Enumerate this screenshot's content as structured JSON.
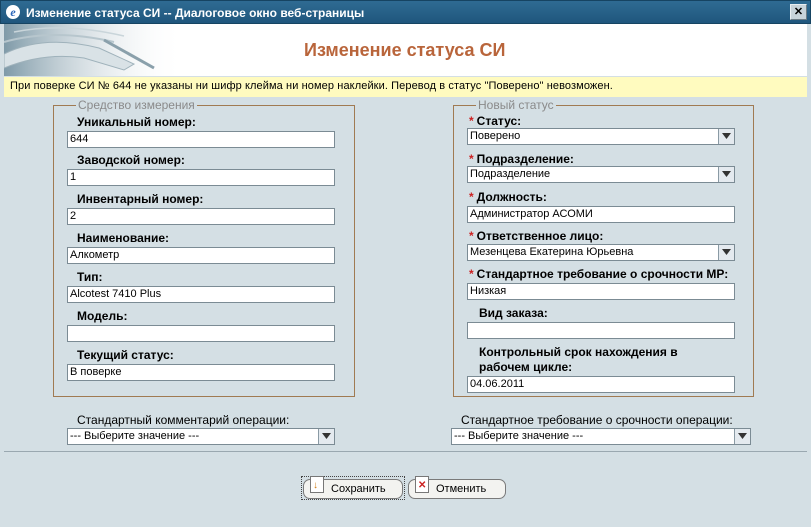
{
  "window": {
    "title": "Изменение статуса СИ -- Диалоговое окно веб-страницы",
    "close_symbol": "✕"
  },
  "header": {
    "heading": "Изменение статуса СИ"
  },
  "warning": "При поверке СИ № 644 не указаны ни шифр клейма ни номер наклейки. Перевод в статус \"Поверено\" невозможен.",
  "instrument": {
    "legend": "Средство измерения",
    "fields": [
      {
        "label": "Уникальный номер:",
        "value": "644"
      },
      {
        "label": "Заводской номер:",
        "value": "1"
      },
      {
        "label": "Инвентарный номер:",
        "value": "2"
      },
      {
        "label": "Наименование:",
        "value": "Алкометр"
      },
      {
        "label": "Тип:",
        "value": "Alcotest 7410 Plus"
      },
      {
        "label": "Модель:",
        "value": ""
      },
      {
        "label": "Текущий статус:",
        "value": "В поверке"
      }
    ]
  },
  "new_status": {
    "legend": "Новый статус",
    "required_mark": "*",
    "status": {
      "label": "Статус:",
      "value": "Поверено"
    },
    "division": {
      "label": "Подразделение:",
      "value": "Подразделение"
    },
    "position": {
      "label": "Должность:",
      "value": "Администратор АСОМИ"
    },
    "responsible": {
      "label": "Ответственное лицо:",
      "value": "Мезенцева Екатерина Юрьевна"
    },
    "urgency": {
      "label": "Стандартное требование о срочности МР:",
      "value": "Низкая"
    },
    "order_type": {
      "label": "Вид заказа:",
      "value": ""
    },
    "deadline": {
      "label_line1": "Контрольный срок нахождения в",
      "label_line2": "рабочем цикле:",
      "value": "04.06.2011"
    }
  },
  "comment": {
    "label": "Стандартный комментарий операции:",
    "value": "--- Выберите значение ---"
  },
  "op_urgency": {
    "label": "Стандартное требование о срочности операции:",
    "value": "--- Выберите значение ---"
  },
  "buttons": {
    "save": "Сохранить",
    "cancel": "Отменить"
  },
  "icons": {
    "save": "save-doc-icon",
    "cancel": "cancel-doc-icon",
    "dropdown": "chevron-down-icon"
  },
  "colors": {
    "heading": "#b9653b",
    "required": "#cc2222",
    "warning_bg": "#fffbbf",
    "titlebar": "#2f6b93"
  }
}
